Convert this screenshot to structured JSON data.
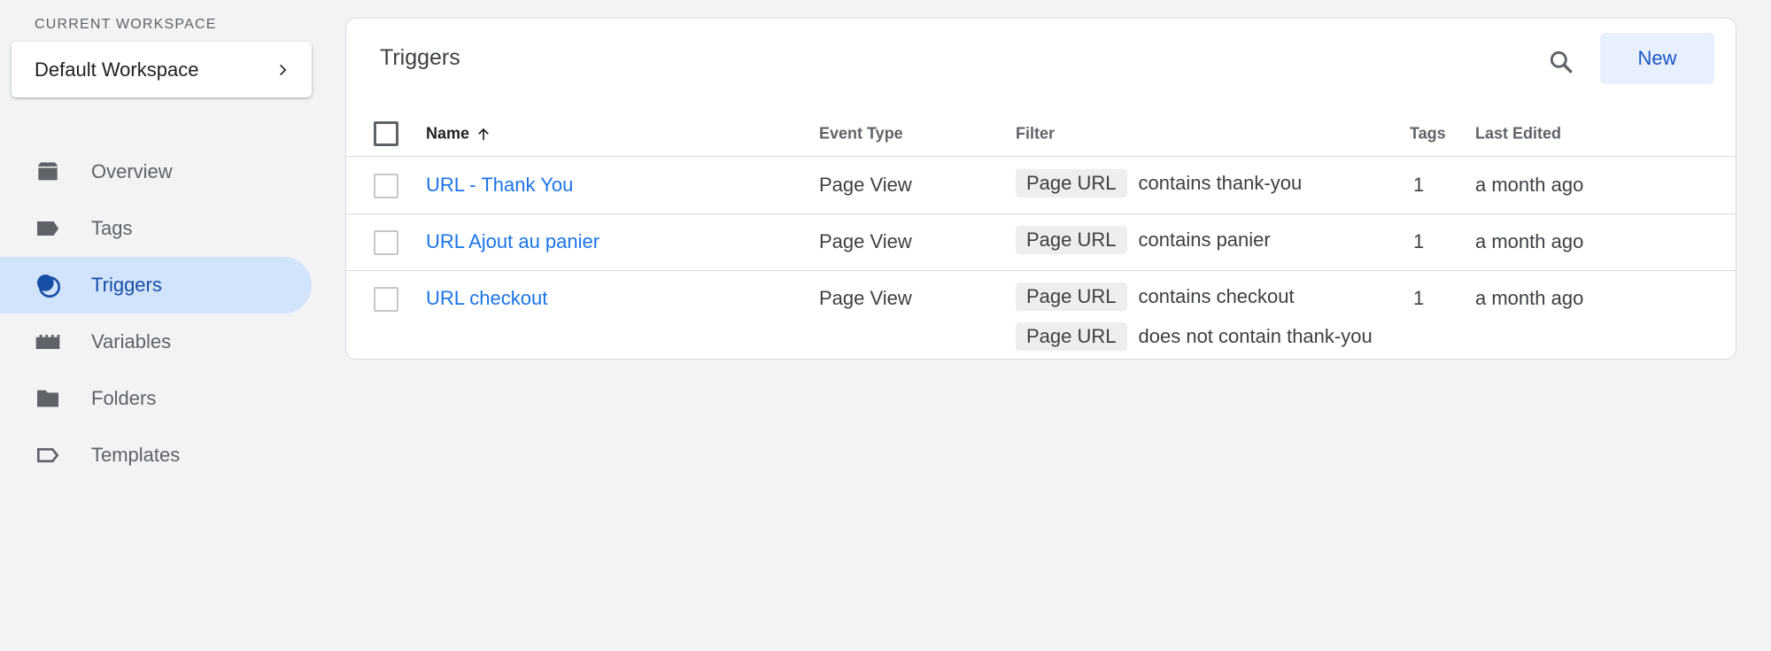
{
  "sidebar": {
    "workspace_label": "CURRENT WORKSPACE",
    "workspace_name": "Default Workspace",
    "items": [
      {
        "label": "Overview",
        "icon": "overview-icon"
      },
      {
        "label": "Tags",
        "icon": "tag-icon"
      },
      {
        "label": "Triggers",
        "icon": "trigger-icon",
        "active": true
      },
      {
        "label": "Variables",
        "icon": "variables-icon"
      },
      {
        "label": "Folders",
        "icon": "folder-icon"
      },
      {
        "label": "Templates",
        "icon": "template-icon"
      }
    ]
  },
  "main": {
    "title": "Triggers",
    "new_label": "New",
    "columns": {
      "name": "Name",
      "event_type": "Event Type",
      "filter": "Filter",
      "tags": "Tags",
      "last_edited": "Last Edited"
    },
    "rows": [
      {
        "name": "URL - Thank You",
        "event_type": "Page View",
        "filters": [
          {
            "field": "Page URL",
            "condition": "contains thank-you"
          }
        ],
        "tags": "1",
        "last_edited": "a month ago"
      },
      {
        "name": "URL Ajout au panier",
        "event_type": "Page View",
        "filters": [
          {
            "field": "Page URL",
            "condition": "contains panier"
          }
        ],
        "tags": "1",
        "last_edited": "a month ago"
      },
      {
        "name": "URL checkout",
        "event_type": "Page View",
        "filters": [
          {
            "field": "Page URL",
            "condition": "contains checkout"
          },
          {
            "field": "Page URL",
            "condition": "does not contain thank-you"
          }
        ],
        "tags": "1",
        "last_edited": "a month ago"
      }
    ]
  },
  "colors": {
    "accent": "#1a73e8",
    "active_nav_bg": "#d2e3fc",
    "new_button_bg": "#e8f0fe"
  }
}
